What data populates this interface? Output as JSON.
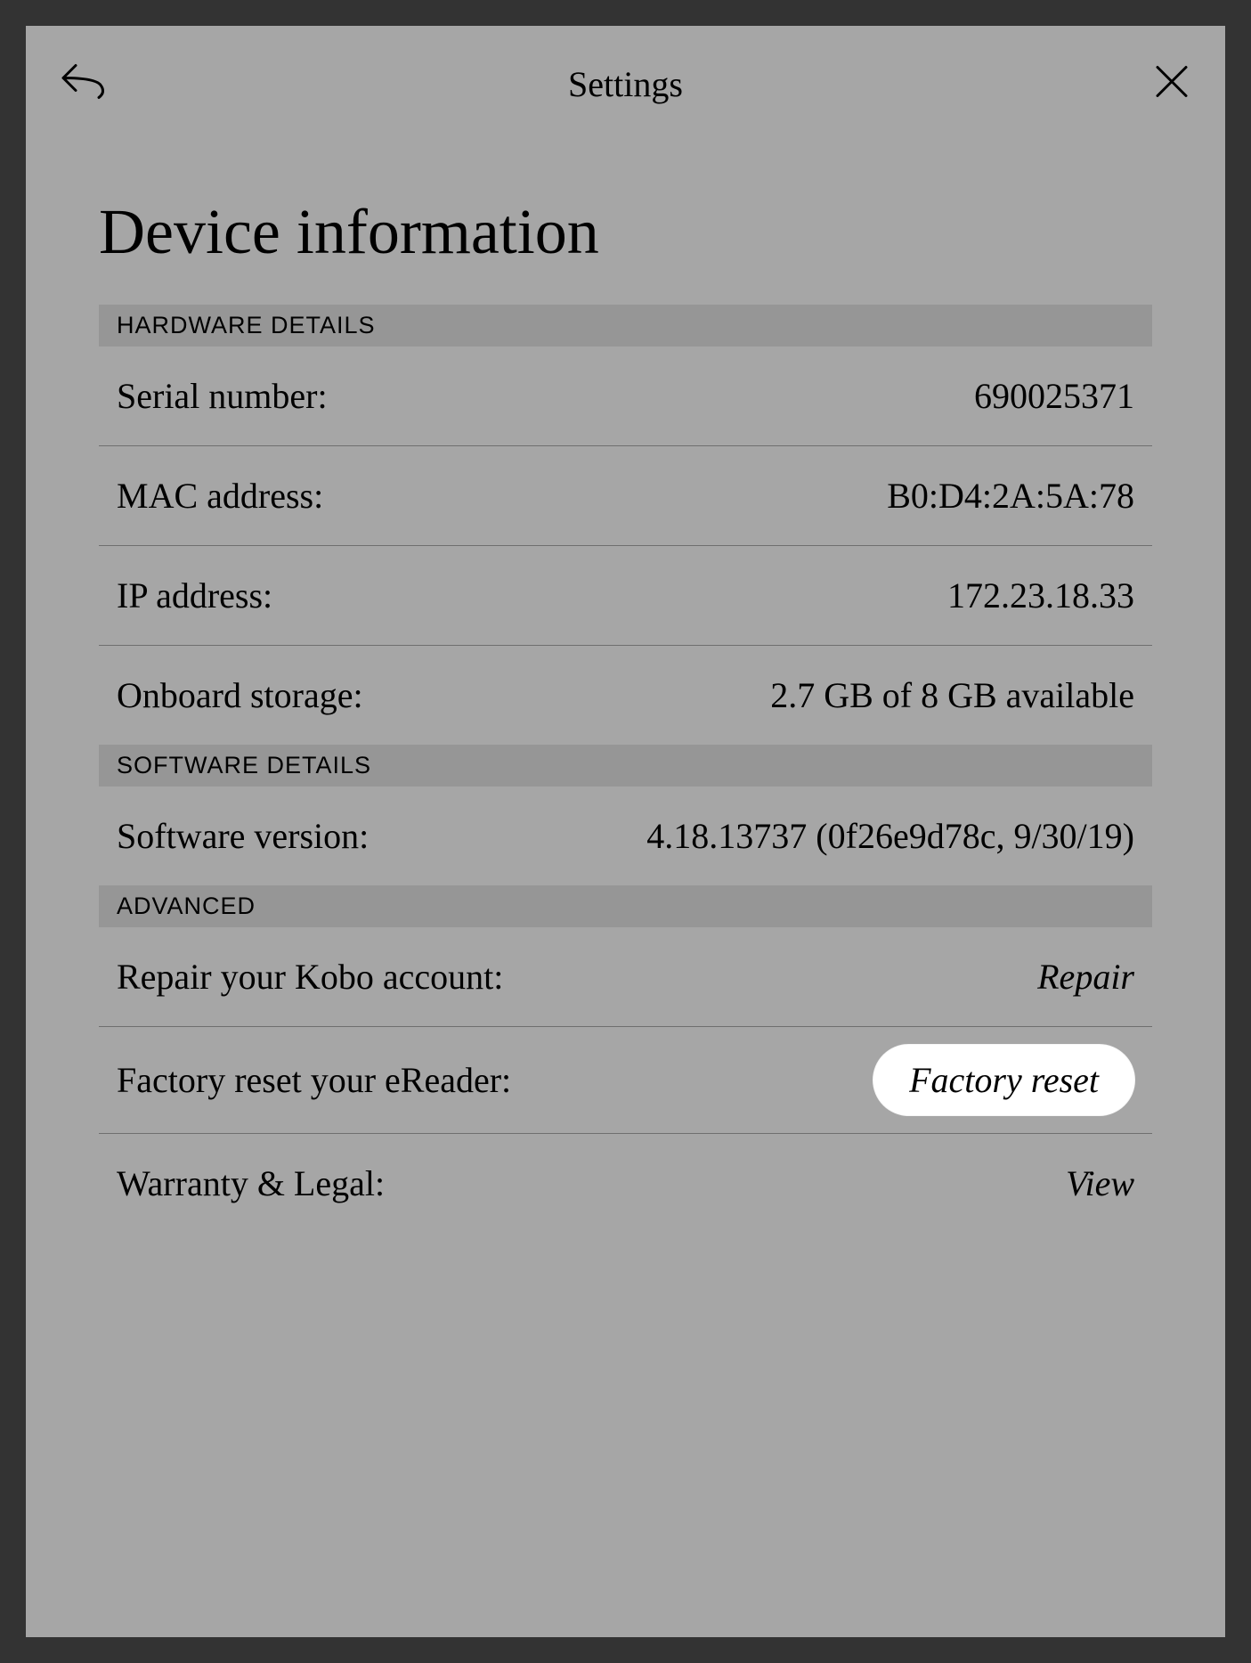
{
  "header": {
    "title": "Settings"
  },
  "page": {
    "title": "Device information"
  },
  "sections": {
    "hardware": {
      "header": "HARDWARE DETAILS",
      "serial": {
        "label": "Serial number:",
        "value": "690025371"
      },
      "mac": {
        "label": "MAC address:",
        "value": "B0:D4:2A:5A:78"
      },
      "ip": {
        "label": "IP address:",
        "value": "172.23.18.33"
      },
      "storage": {
        "label": "Onboard storage:",
        "value": "2.7 GB of 8 GB available"
      }
    },
    "software": {
      "header": "SOFTWARE DETAILS",
      "version": {
        "label": "Software version:",
        "value": "4.18.13737 (0f26e9d78c, 9/30/19)"
      }
    },
    "advanced": {
      "header": "ADVANCED",
      "repair": {
        "label": "Repair your Kobo account:",
        "action": "Repair"
      },
      "reset": {
        "label": "Factory reset your eReader:",
        "action": "Factory reset"
      },
      "warranty": {
        "label": "Warranty & Legal:",
        "action": "View"
      }
    }
  }
}
